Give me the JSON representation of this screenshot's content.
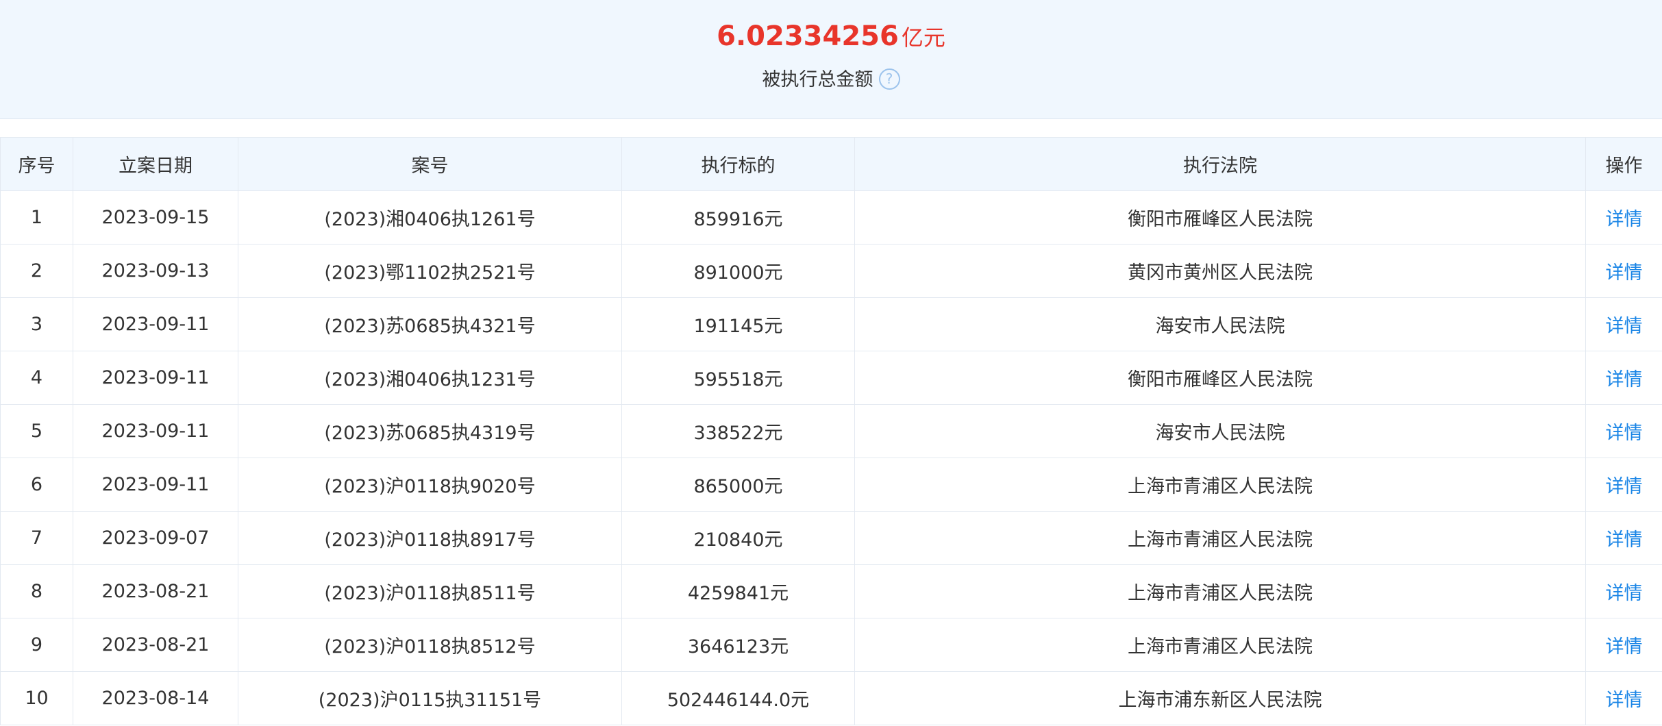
{
  "summary": {
    "amount_value": "6.02334256",
    "amount_unit": "亿元",
    "amount_label": "被执行总金额",
    "help_icon": "question-circle-icon",
    "help_glyph": "?"
  },
  "colors": {
    "amount": "#e8352b",
    "link": "#1a85e6",
    "header_bg": "#f0f7fe",
    "border": "#e3e9f1"
  },
  "table": {
    "headers": [
      "序号",
      "立案日期",
      "案号",
      "执行标的",
      "执行法院",
      "操作"
    ],
    "rows": [
      {
        "index": "1",
        "date": "2023-09-15",
        "case_no": "(2023)湘0406执1261号",
        "amount": "859916元",
        "court": "衡阳市雁峰区人民法院",
        "action": "详情"
      },
      {
        "index": "2",
        "date": "2023-09-13",
        "case_no": "(2023)鄂1102执2521号",
        "amount": "891000元",
        "court": "黄冈市黄州区人民法院",
        "action": "详情"
      },
      {
        "index": "3",
        "date": "2023-09-11",
        "case_no": "(2023)苏0685执4321号",
        "amount": "191145元",
        "court": "海安市人民法院",
        "action": "详情"
      },
      {
        "index": "4",
        "date": "2023-09-11",
        "case_no": "(2023)湘0406执1231号",
        "amount": "595518元",
        "court": "衡阳市雁峰区人民法院",
        "action": "详情"
      },
      {
        "index": "5",
        "date": "2023-09-11",
        "case_no": "(2023)苏0685执4319号",
        "amount": "338522元",
        "court": "海安市人民法院",
        "action": "详情"
      },
      {
        "index": "6",
        "date": "2023-09-11",
        "case_no": "(2023)沪0118执9020号",
        "amount": "865000元",
        "court": "上海市青浦区人民法院",
        "action": "详情"
      },
      {
        "index": "7",
        "date": "2023-09-07",
        "case_no": "(2023)沪0118执8917号",
        "amount": "210840元",
        "court": "上海市青浦区人民法院",
        "action": "详情"
      },
      {
        "index": "8",
        "date": "2023-08-21",
        "case_no": "(2023)沪0118执8511号",
        "amount": "4259841元",
        "court": "上海市青浦区人民法院",
        "action": "详情"
      },
      {
        "index": "9",
        "date": "2023-08-21",
        "case_no": "(2023)沪0118执8512号",
        "amount": "3646123元",
        "court": "上海市青浦区人民法院",
        "action": "详情"
      },
      {
        "index": "10",
        "date": "2023-08-14",
        "case_no": "(2023)沪0115执31151号",
        "amount": "502446144.0元",
        "court": "上海市浦东新区人民法院",
        "action": "详情"
      }
    ]
  }
}
